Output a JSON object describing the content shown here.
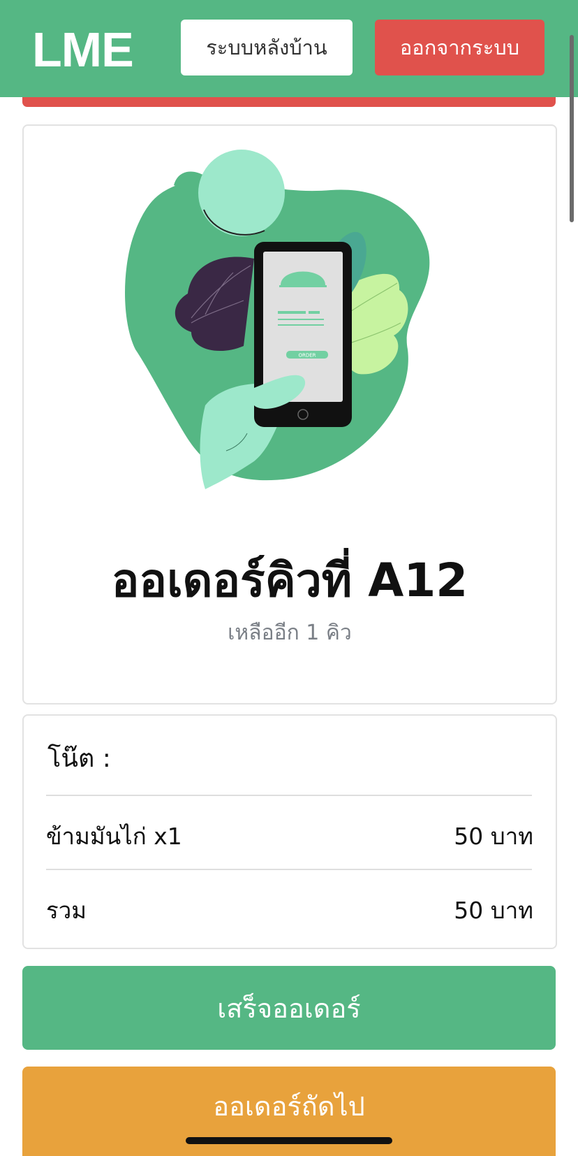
{
  "header": {
    "logo": "LME",
    "backoffice_label": "ระบบหลังบ้าน",
    "logout_label": "ออกจากระบบ"
  },
  "hero": {
    "title": "ออเดอร์คิวที่ A12",
    "subtitle": "เหลืออีก 1 คิว",
    "illustration_button_text": "ORDER"
  },
  "order": {
    "note_label": "โน๊ต :",
    "items": [
      {
        "name": "ข้ามมันไก่ x1",
        "price": "50 บาท"
      }
    ],
    "total_label": "รวม",
    "total_value": "50 บาท"
  },
  "actions": {
    "finish_label": "เสร็จออเดอร์",
    "next_label": "ออเดอร์ถัดไป"
  },
  "colors": {
    "primary": "#55b784",
    "danger": "#e0524c",
    "warning": "#e8a23c"
  }
}
